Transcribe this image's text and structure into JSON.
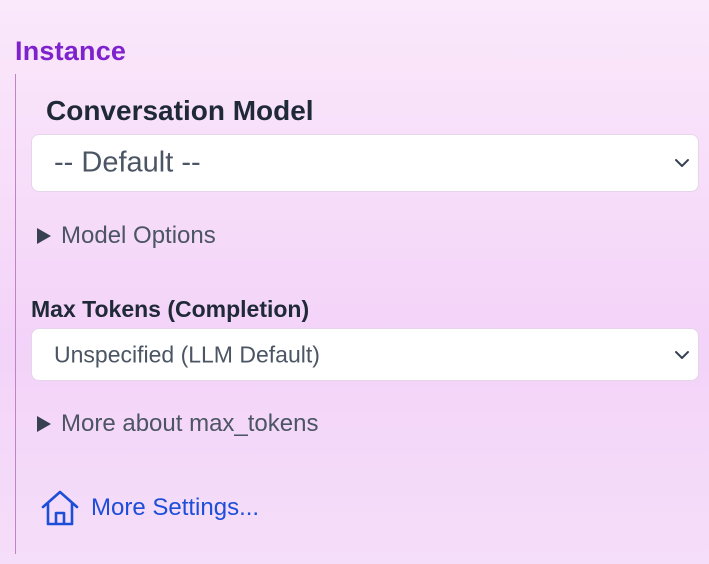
{
  "section": {
    "title": "Instance"
  },
  "conversation_model": {
    "label": "Conversation Model",
    "selected": "-- Default --",
    "options_toggle": "Model Options"
  },
  "max_tokens": {
    "label": "Max Tokens (Completion)",
    "selected": "Unspecified (LLM Default)",
    "more_toggle": "More about max_tokens"
  },
  "more_settings": {
    "label": "More Settings...",
    "icon": "home-icon"
  },
  "colors": {
    "title": "#7e22ce",
    "link": "#1d4ed8",
    "text": "#1f2937",
    "muted": "#4b5563"
  }
}
